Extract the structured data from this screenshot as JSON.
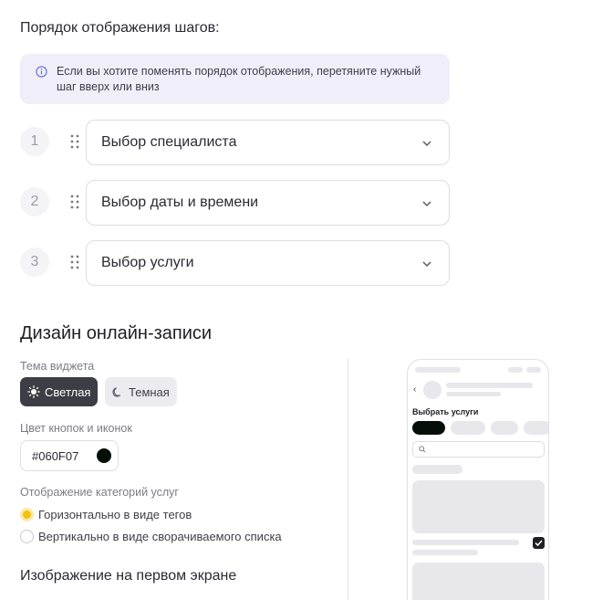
{
  "steps": {
    "title": "Порядок отображения шагов:",
    "info_text": "Если вы хотите поменять порядок отображения, перетяните нужный шаг вверх или вниз",
    "items": [
      {
        "number": "1",
        "label": "Выбор специалиста"
      },
      {
        "number": "2",
        "label": "Выбор даты и времени"
      },
      {
        "number": "3",
        "label": "Выбор услуги"
      }
    ]
  },
  "design": {
    "title": "Дизайн онлайн-записи",
    "theme_label": "Тема виджета",
    "theme_light": "Светлая",
    "theme_dark": "Темная",
    "theme_selected": "Светлая",
    "color_label": "Цвет кнопок и иконок",
    "color_value": "#060F07",
    "categories_label": "Отображение категорий услуг",
    "option_horizontal": "Горизонтально в виде тегов",
    "option_vertical": "Вертикально в виде сворачиваемого списка",
    "option_selected": "Горизонтально в виде тегов",
    "image_title": "Изображение на первом экране"
  },
  "preview": {
    "back_icon": "‹",
    "title": "Выбрать услуги"
  },
  "colors": {
    "accent": "#060F07",
    "radio_active": "#f5c10e",
    "info_bg": "#efeef9"
  }
}
